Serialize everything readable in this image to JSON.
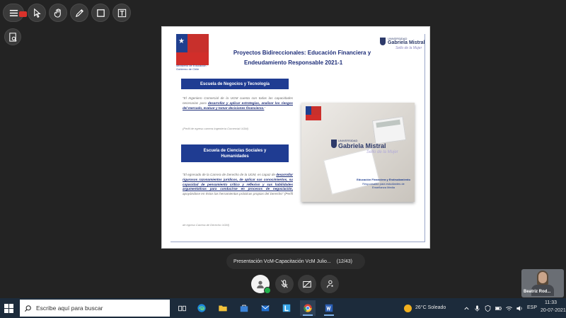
{
  "slide": {
    "title_line1": "Proyectos Bidireccionales: Educación Financiera y",
    "title_line2": "Endeudamiento Responsable 2021-1",
    "gov_logo_text": "Ministerio de Educación · Gobierno de Chile",
    "ugm_logo": {
      "small": "UNIVERSIDAD",
      "name": "Gabriela Mistral",
      "tagline": "Sello de la Mujer"
    },
    "school1": {
      "name": "Escuela de Negocios y Tecnología",
      "quote_pre": "\"El Ingeniero Comercial de la UGM cuenta con todas las capacidades necesarias para ",
      "quote_emph": "desarrollar y aplicar estrategias, analizar los riesgos del mercado, evaluar y tomar decisiones financieras.",
      "quote_post": "\"",
      "source": "(Perfil de egreso carrera Ingeniería Comercial UGM)"
    },
    "school2": {
      "name": "Escuela de Ciencias Sociales y Humanidades",
      "quote_pre": "\"El egresado de la Carrera de Derecho de la UGM, es capaz de ",
      "quote_emph": "desarrollar rigurosos razonamientos jurídicos, de aplicar sus conocimientos, su capacidad de pensamiento crítico y reflexivo y sus habilidades argumentativas para conducirse en procesos de negociación,",
      "quote_post": " apoyándose en éstos las herramientas prácticas propias del Derecho\" (Perfil",
      "source": "de egreso Carrera de Derecho UGM)"
    },
    "photo": {
      "ugm_small": "UNIVERSIDAD",
      "ugm_name": "Gabriela Mistral",
      "ugm_tag": "Sello de la Mujer",
      "caption_line1": "Educación Financiera y Endeudamiento",
      "caption_line2": "Responsable para estudiantes de",
      "caption_line3": "Enseñanza Media"
    }
  },
  "caption_bar": {
    "title": "Presentación VcM-Capacitación VcM Julio...",
    "page": "(12/43)"
  },
  "participant": {
    "name": "Beatriz Rod..."
  },
  "taskbar": {
    "search_placeholder": "Escribe aquí para buscar",
    "weather": "26°C  Soleado",
    "language": "ESP",
    "time": "11:33",
    "date": "20-07-2021"
  },
  "colors": {
    "accent_blue": "#1f3c92",
    "gov_red": "#d12e2a",
    "taskbar": "#1c2b3b"
  },
  "icons": {
    "toolbar": [
      "menu-icon",
      "pointer-icon",
      "hand-icon",
      "pen-icon",
      "rectangle-icon",
      "text-stamp-icon",
      "search-document-icon"
    ],
    "call": [
      "avatar-icon",
      "mic-off-icon",
      "camera-off-icon",
      "participants-icon"
    ],
    "apps": [
      "task-view-icon",
      "edge-icon",
      "file-explorer-icon",
      "store-icon",
      "mail-icon",
      "l-app-icon",
      "chrome-icon",
      "word-icon"
    ]
  }
}
